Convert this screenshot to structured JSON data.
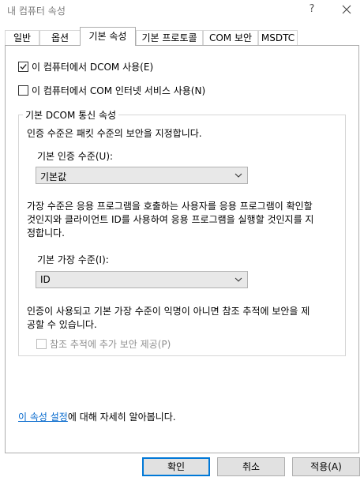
{
  "window": {
    "title": "내 컴퓨터 속성",
    "help_glyph": "?"
  },
  "tabs": [
    {
      "label": "일반"
    },
    {
      "label": "옵션"
    },
    {
      "label": "기본 속성"
    },
    {
      "label": "기본 프로토콜"
    },
    {
      "label": "COM 보안"
    },
    {
      "label": "MSDTC"
    }
  ],
  "active_tab": "기본 속성",
  "enable_dcom": {
    "label": "이 컴퓨터에서 DCOM 사용(E)",
    "checked": true
  },
  "enable_com_internet": {
    "label": "이 컴퓨터에서 COM 인터넷 서비스 사용(N)",
    "checked": false
  },
  "group": {
    "title": "기본 DCOM 통신 속성",
    "auth_desc": "인증 수준은 패킷 수준의 보안을 지정합니다.",
    "auth_label": "기본 인증 수준(U):",
    "auth_value": "기본값",
    "imp_desc_lines": [
      "가장 수준은 응용 프로그램을 호출하는 사용자를 응용 프로그램이 확인할",
      "것인지와 클라이언트 ID를 사용하여 응용 프로그램을 실행할 것인지를 지",
      "정합니다."
    ],
    "imp_label": "기본 가장 수준(I):",
    "imp_value": "ID",
    "ref_desc_lines": [
      "인증이 사용되고 기본 가장 수준이 익명이 아니면 참조 추적에 보안을 제",
      "공할 수 있습니다."
    ],
    "ref_tracking": {
      "label": "참조 추적에 추가 보안 제공(P)",
      "checked": false,
      "disabled": true
    }
  },
  "help_link": {
    "link_text": "이 속성 설정",
    "rest_text": "에 대해 자세히 알아봅니다."
  },
  "buttons": {
    "ok": "확인",
    "cancel": "취소",
    "apply": "적용(A)"
  }
}
